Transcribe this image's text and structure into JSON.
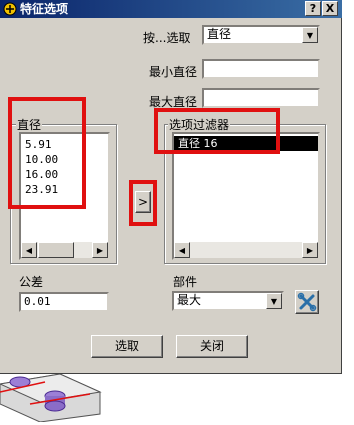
{
  "window": {
    "title": "特征选项",
    "help_label": "?",
    "close_label": "X"
  },
  "select_by": {
    "label": "按...选取",
    "value": "直径"
  },
  "min_diameter": {
    "label": "最小直径",
    "value": ""
  },
  "max_diameter": {
    "label": "最大直径",
    "value": ""
  },
  "diameter_group": {
    "title": "直径",
    "items": [
      "5.91",
      "10.00",
      "16.00",
      "23.91"
    ]
  },
  "filter_group": {
    "title": "选项过滤器",
    "items": [
      "直径  16"
    ]
  },
  "add_arrow": ">",
  "tolerance": {
    "label": "公差",
    "value": "0.01"
  },
  "part": {
    "label": "部件",
    "value": "最大"
  },
  "buttons": {
    "select": "选取",
    "close": "关闭"
  },
  "colors": {
    "highlight": "#e01010",
    "title_bar": "#0a246a",
    "dialog_bg": "#d4d0c8"
  }
}
